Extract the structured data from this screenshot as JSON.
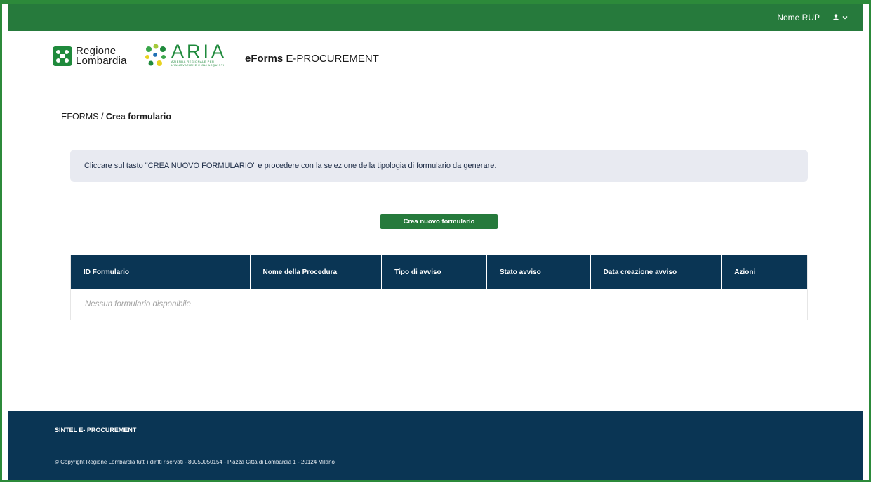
{
  "topbar": {
    "user_name": "Nome RUP",
    "user_icon": "user-icon",
    "dropdown_icon": "chevron-down-icon"
  },
  "header": {
    "logo_regione_line1": "Regione",
    "logo_regione_line2": "Lombardia",
    "logo_aria_name": "ARIA",
    "logo_aria_sub1": "AZIENDA REGIONALE PER",
    "logo_aria_sub2": "L'INNOVAZIONE E GLI ACQUISTI",
    "app_title_bold": "eForms",
    "app_title_rest": " E-PROCUREMENT"
  },
  "breadcrumb": {
    "root": "EFORMS",
    "separator": " / ",
    "current": "Crea formulario"
  },
  "info": {
    "message": "Cliccare sul tasto \"CREA NUOVO FORMULARIO\" e procedere con la selezione della tipologia di formulario da generare."
  },
  "actions": {
    "create_label": "Crea nuovo formulario"
  },
  "table": {
    "columns": [
      "ID Formulario",
      "Nome della Procedura",
      "Tipo di avviso",
      "Stato avviso",
      "Data creazione avviso",
      "Azioni"
    ],
    "empty_message": "Nessun formulario disponibile"
  },
  "footer": {
    "brand": "SINTEL E- PROCUREMENT",
    "copyright": "© Copyright Regione Lombardia tutti i diritti riservati - 80050050154 - Piazza Città di Lombardia 1 - 20124 Milano"
  },
  "colors": {
    "primary_green": "#267a3c",
    "navy": "#0a3554",
    "info_bg": "#e8eaf1"
  }
}
